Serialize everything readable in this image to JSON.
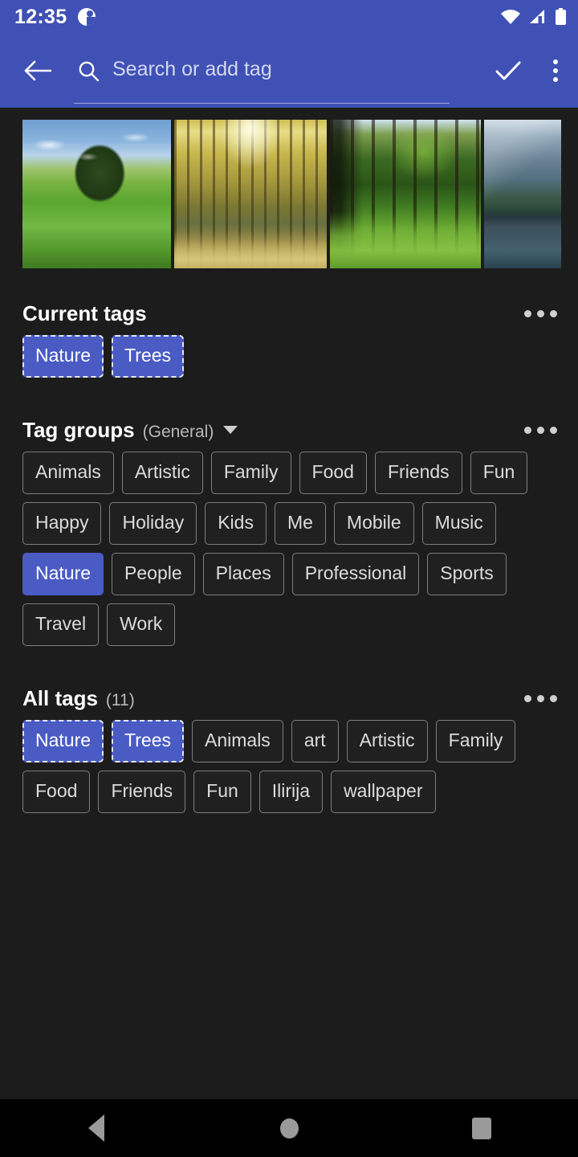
{
  "status_bar": {
    "time": "12:35",
    "notification_icon": "clock-notification-icon",
    "wifi_icon": "wifi-icon",
    "signal_icon": "cellular-signal-icon",
    "battery_icon": "battery-full-icon"
  },
  "app_bar": {
    "back_icon": "back-arrow-icon",
    "search_icon": "search-icon",
    "search_value": "",
    "search_placeholder": "Search or add tag",
    "confirm_icon": "check-icon",
    "overflow_icon": "more-vert-icon",
    "accent_color": "#3f51b5"
  },
  "thumbnails": [
    {
      "alt": "Lone oak tree in green meadow",
      "style": "ph-meadow",
      "size": "t1"
    },
    {
      "alt": "Sunlit avenue of yellow poplar trees",
      "style": "ph-avenue",
      "size": "t2"
    },
    {
      "alt": "Grove of trees over sunlit grass",
      "style": "ph-grove",
      "size": "t3"
    },
    {
      "alt": "Mountain lake with reflections",
      "style": "ph-lake",
      "size": "t4"
    }
  ],
  "current_tags": {
    "title": "Current tags",
    "overflow_icon": "more-horiz-icon",
    "tags": [
      {
        "label": "Nature",
        "selected": true
      },
      {
        "label": "Trees",
        "selected": true
      }
    ]
  },
  "tag_groups": {
    "title": "Tag groups",
    "selected_group": "(General)",
    "dropdown_icon": "chevron-down-icon",
    "overflow_icon": "more-horiz-icon",
    "tags": [
      {
        "label": "Animals",
        "selected": false
      },
      {
        "label": "Artistic",
        "selected": false
      },
      {
        "label": "Family",
        "selected": false
      },
      {
        "label": "Food",
        "selected": false
      },
      {
        "label": "Friends",
        "selected": false
      },
      {
        "label": "Fun",
        "selected": false
      },
      {
        "label": "Happy",
        "selected": false
      },
      {
        "label": "Holiday",
        "selected": false
      },
      {
        "label": "Kids",
        "selected": false
      },
      {
        "label": "Me",
        "selected": false
      },
      {
        "label": "Mobile",
        "selected": false
      },
      {
        "label": "Music",
        "selected": false
      },
      {
        "label": "Nature",
        "selected": true
      },
      {
        "label": "People",
        "selected": false
      },
      {
        "label": "Places",
        "selected": false
      },
      {
        "label": "Professional",
        "selected": false
      },
      {
        "label": "Sports",
        "selected": false
      },
      {
        "label": "Travel",
        "selected": false
      },
      {
        "label": "Work",
        "selected": false
      }
    ]
  },
  "all_tags": {
    "title": "All tags",
    "count": "(11)",
    "overflow_icon": "more-horiz-icon",
    "tags": [
      {
        "label": "Nature",
        "current": true
      },
      {
        "label": "Trees",
        "current": true
      },
      {
        "label": "Animals",
        "current": false
      },
      {
        "label": "art",
        "current": false
      },
      {
        "label": "Artistic",
        "current": false
      },
      {
        "label": "Family",
        "current": false
      },
      {
        "label": "Food",
        "current": false
      },
      {
        "label": "Friends",
        "current": false
      },
      {
        "label": "Fun",
        "current": false
      },
      {
        "label": "Ilirija",
        "current": false
      },
      {
        "label": "wallpaper",
        "current": false
      }
    ]
  },
  "nav_bar": {
    "back_icon": "nav-back-icon",
    "home_icon": "nav-home-icon",
    "recents_icon": "nav-recents-icon"
  },
  "colors": {
    "accent": "#3f51b5",
    "chip_selected": "#4a5bc4",
    "background": "#1c1c1c",
    "chip_border": "#7d7d7d"
  }
}
